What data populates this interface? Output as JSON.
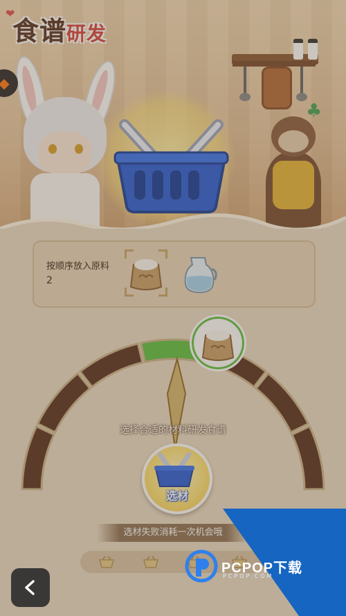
{
  "header": {
    "title_main": "食谱",
    "title_sub": "研发"
  },
  "recipe_card": {
    "instruction": "按顺序放入原料",
    "count": "2",
    "ingredients": [
      "flour-sack-icon",
      "milk-jug-icon"
    ]
  },
  "gauge": {
    "progress_fraction": 0.53,
    "segments": 7
  },
  "prompt": "选择合适的材料研发食谱",
  "select_button": {
    "label": "选材"
  },
  "notice": "选材失败消耗一次机会哦",
  "attempts": {
    "total": 4
  },
  "watermark": {
    "brand": "PCPOP下载",
    "small": "PCPOP.COM"
  },
  "colors": {
    "accent_green": "#5fc144",
    "basket_blue": "#2b5fd9",
    "title_red": "#d8443c",
    "watermark_blue": "#1665c0"
  }
}
